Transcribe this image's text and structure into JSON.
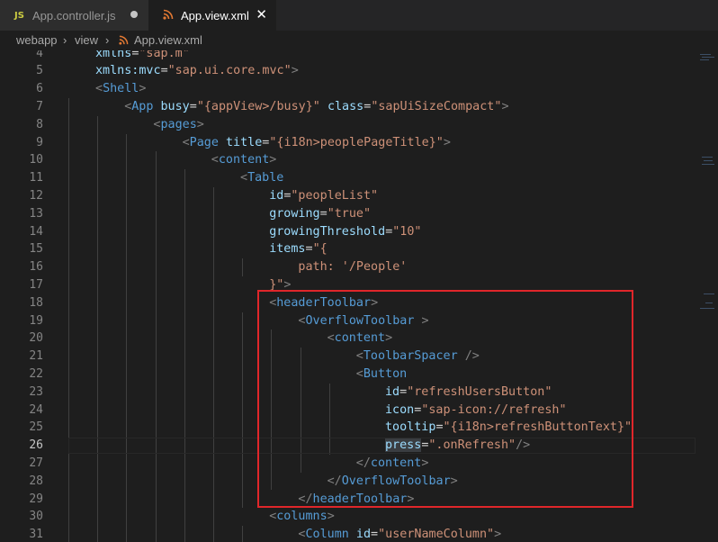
{
  "tabs": [
    {
      "icon": "JS",
      "label": "App.controller.js",
      "active": false,
      "modified": true
    },
    {
      "icon": "rss-xml-icon",
      "label": "App.view.xml",
      "active": true,
      "close": "✕"
    }
  ],
  "breadcrumb": {
    "items": [
      "webapp",
      "view",
      "App.view.xml"
    ],
    "separator": "›"
  },
  "editor": {
    "current_line": "26",
    "lines": [
      {
        "n": "4",
        "tokens": [
          [
            "attr",
            "xmlns"
          ],
          [
            "txt",
            "="
          ],
          [
            "str",
            "\"sap.m\""
          ]
        ]
      },
      {
        "n": "5",
        "tokens": [
          [
            "attr",
            "xmlns:mvc"
          ],
          [
            "txt",
            "="
          ],
          [
            "str",
            "\"sap.ui.core.mvc\""
          ],
          [
            "t",
            ">"
          ]
        ]
      },
      {
        "n": "6",
        "tokens": [
          [
            "t",
            "<"
          ],
          [
            "tag",
            "Shell"
          ],
          [
            "t",
            ">"
          ]
        ]
      },
      {
        "n": "7",
        "tokens": [
          [
            "t",
            "<"
          ],
          [
            "tag",
            "App"
          ],
          [
            "txt",
            " "
          ],
          [
            "attr",
            "busy"
          ],
          [
            "txt",
            "="
          ],
          [
            "str",
            "\"{appView>/busy}\""
          ],
          [
            "txt",
            " "
          ],
          [
            "attr",
            "class"
          ],
          [
            "txt",
            "="
          ],
          [
            "str",
            "\"sapUiSizeCompact\""
          ],
          [
            "t",
            ">"
          ]
        ]
      },
      {
        "n": "8",
        "tokens": [
          [
            "t",
            "<"
          ],
          [
            "tag",
            "pages"
          ],
          [
            "t",
            ">"
          ]
        ]
      },
      {
        "n": "9",
        "tokens": [
          [
            "t",
            "<"
          ],
          [
            "tag",
            "Page"
          ],
          [
            "txt",
            " "
          ],
          [
            "attr",
            "title"
          ],
          [
            "txt",
            "="
          ],
          [
            "str",
            "\"{i18n>peoplePageTitle}\""
          ],
          [
            "t",
            ">"
          ]
        ]
      },
      {
        "n": "10",
        "tokens": [
          [
            "t",
            "<"
          ],
          [
            "tag",
            "content"
          ],
          [
            "t",
            ">"
          ]
        ]
      },
      {
        "n": "11",
        "tokens": [
          [
            "t",
            "<"
          ],
          [
            "tag",
            "Table"
          ]
        ]
      },
      {
        "n": "12",
        "tokens": [
          [
            "attr",
            "id"
          ],
          [
            "txt",
            "="
          ],
          [
            "str",
            "\"peopleList\""
          ]
        ]
      },
      {
        "n": "13",
        "tokens": [
          [
            "attr",
            "growing"
          ],
          [
            "txt",
            "="
          ],
          [
            "str",
            "\"true\""
          ]
        ]
      },
      {
        "n": "14",
        "tokens": [
          [
            "attr",
            "growingThreshold"
          ],
          [
            "txt",
            "="
          ],
          [
            "str",
            "\"10\""
          ]
        ]
      },
      {
        "n": "15",
        "tokens": [
          [
            "attr",
            "items"
          ],
          [
            "txt",
            "="
          ],
          [
            "str",
            "\"{"
          ]
        ]
      },
      {
        "n": "16",
        "tokens": [
          [
            "str",
            "path: '/People'"
          ]
        ]
      },
      {
        "n": "17",
        "tokens": [
          [
            "str",
            "}\""
          ],
          [
            "t",
            ">"
          ]
        ]
      },
      {
        "n": "18",
        "tokens": [
          [
            "t",
            "<"
          ],
          [
            "tag",
            "headerToolbar"
          ],
          [
            "t",
            ">"
          ]
        ]
      },
      {
        "n": "19",
        "tokens": [
          [
            "t",
            "<"
          ],
          [
            "tag",
            "OverflowToolbar"
          ],
          [
            "txt",
            " "
          ],
          [
            "t",
            ">"
          ]
        ]
      },
      {
        "n": "20",
        "tokens": [
          [
            "t",
            "<"
          ],
          [
            "tag",
            "content"
          ],
          [
            "t",
            ">"
          ]
        ]
      },
      {
        "n": "21",
        "tokens": [
          [
            "t",
            "<"
          ],
          [
            "tag",
            "ToolbarSpacer"
          ],
          [
            "txt",
            " "
          ],
          [
            "t",
            "/>"
          ]
        ]
      },
      {
        "n": "22",
        "tokens": [
          [
            "t",
            "<"
          ],
          [
            "tag",
            "Button"
          ]
        ]
      },
      {
        "n": "23",
        "tokens": [
          [
            "attr",
            "id"
          ],
          [
            "txt",
            "="
          ],
          [
            "str",
            "\"refreshUsersButton\""
          ]
        ]
      },
      {
        "n": "24",
        "tokens": [
          [
            "attr",
            "icon"
          ],
          [
            "txt",
            "="
          ],
          [
            "str",
            "\"sap-icon://refresh\""
          ]
        ]
      },
      {
        "n": "25",
        "tokens": [
          [
            "attr",
            "tooltip"
          ],
          [
            "txt",
            "="
          ],
          [
            "str",
            "\"{i18n>refreshButtonText}\""
          ]
        ]
      },
      {
        "n": "26",
        "tokens": [
          [
            "sel",
            "press"
          ],
          [
            "txt",
            "="
          ],
          [
            "str",
            "\".onRefresh\""
          ],
          [
            "t",
            "/>"
          ]
        ]
      },
      {
        "n": "27",
        "tokens": [
          [
            "t",
            "</"
          ],
          [
            "tag",
            "content"
          ],
          [
            "t",
            ">"
          ]
        ]
      },
      {
        "n": "28",
        "tokens": [
          [
            "t",
            "</"
          ],
          [
            "tag",
            "OverflowToolbar"
          ],
          [
            "t",
            ">"
          ]
        ]
      },
      {
        "n": "29",
        "tokens": [
          [
            "t",
            "</"
          ],
          [
            "tag",
            "headerToolbar"
          ],
          [
            "t",
            ">"
          ]
        ]
      },
      {
        "n": "30",
        "tokens": [
          [
            "t",
            "<"
          ],
          [
            "tag",
            "columns"
          ],
          [
            "t",
            ">"
          ]
        ]
      },
      {
        "n": "31",
        "tokens": [
          [
            "t",
            "<"
          ],
          [
            "tag",
            "Column"
          ],
          [
            "txt",
            " "
          ],
          [
            "attr",
            "id"
          ],
          [
            "txt",
            "="
          ],
          [
            "str",
            "\"userNameColumn\""
          ],
          [
            "t",
            ">"
          ]
        ]
      }
    ]
  }
}
